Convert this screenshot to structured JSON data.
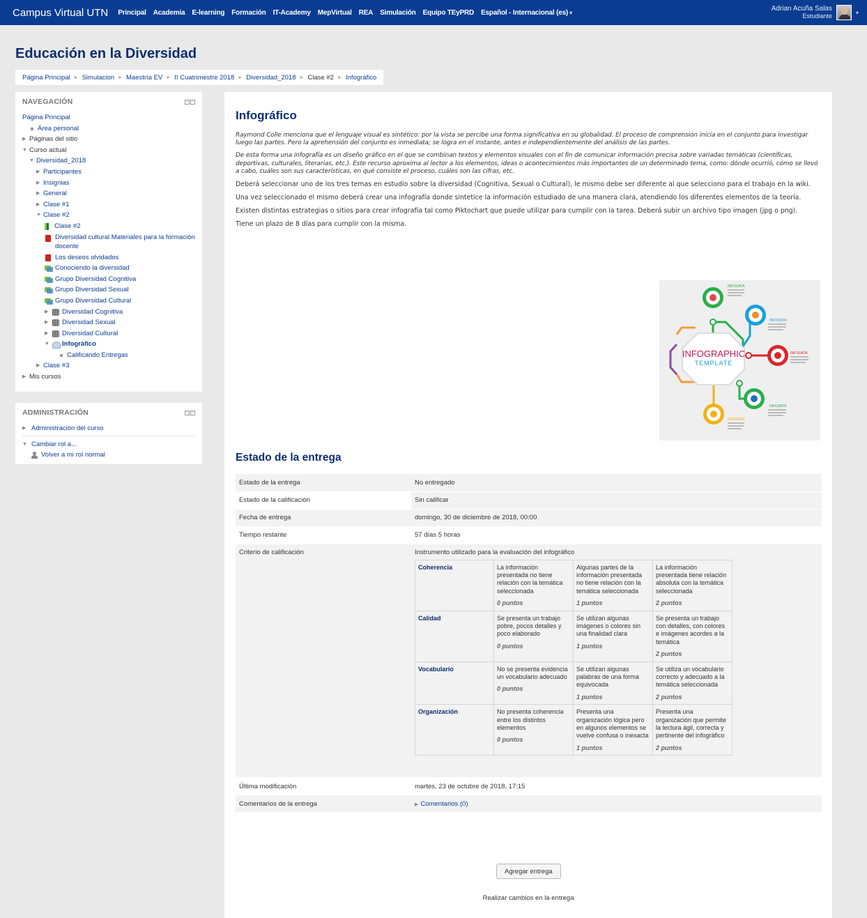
{
  "navbar": {
    "brand": "Campus Virtual UTN",
    "items": [
      "Principal",
      "Academia",
      "E-learning",
      "Formación",
      "IT-Academy",
      "MepVirtual",
      "REA",
      "Simulación",
      "Equipo TEyPRD",
      "Español - Internacional (es)"
    ],
    "user_name": "Adrian Acuña Salas",
    "user_role": "Estudiante"
  },
  "page": {
    "title": "Educación en la Diversidad",
    "breadcrumb": [
      "Página Principal",
      "Simulacion",
      "Maestría EV",
      "II Cuatrimestre 2018",
      "Diversidad_2018",
      "Clase #2",
      "Infográfico"
    ]
  },
  "navigation": {
    "title": "NAVEGACIÓN",
    "items": [
      {
        "label": "Página Principal"
      },
      {
        "label": "Área personal"
      },
      {
        "label": "Páginas del sitio"
      },
      {
        "label": "Curso actual"
      },
      {
        "label": "Diversidad_2018"
      },
      {
        "label": "Participantes"
      },
      {
        "label": "Insignias"
      },
      {
        "label": "General"
      },
      {
        "label": "Clase #1"
      },
      {
        "label": "Clase #2"
      },
      {
        "label": "Clase #2"
      },
      {
        "label": "Diversidad cultural Materiales para la formación docente"
      },
      {
        "label": "Los deseos olvidados"
      },
      {
        "label": "Conociendo la diversidad"
      },
      {
        "label": "Grupo Diversidad Cognitiva"
      },
      {
        "label": "Grupo Diversidad Sexual"
      },
      {
        "label": "Grupo Diversidad Cultural"
      },
      {
        "label": "Diversidad Cognitiva"
      },
      {
        "label": "Diversidad Sexual"
      },
      {
        "label": "Diversidad Cultural"
      },
      {
        "label": "Infográfico"
      },
      {
        "label": "Calificando Entregas"
      },
      {
        "label": "Clase #3"
      },
      {
        "label": "Mis cursos"
      }
    ]
  },
  "administration": {
    "title": "ADMINISTRACIÓN",
    "course_admin": "Administración del curso",
    "switch_role": "Cambiar rol a...",
    "return_role": "Volver a mi rol normal"
  },
  "assignment": {
    "title": "Infográfico",
    "intro": [
      "Raymond Colle menciona que el lenguaje visual es sintético: por la vista se percibe una forma significativa en su globalidad. El proceso de comprensión inicia en el conjunto para investigar luego las partes. Pero la aprehensión del conjunto es inmediata; se logra en el instante, antes e independientemente del análisis de las partes.",
      "De esta forma una infografía es un diseño gráfico en el que se combinan textos y elementos visuales con el fin de comunicar información precisa sobre variadas temáticas (científicas, deportivas, culturales, literarias, etc.). Este recurso aproxima al lector a los elementos, ideas o acontecimientos más importantes de un determinado tema, como: dónde ocurrió, cómo se llevó a cabo, cuáles son sus características, en qué consiste el proceso, cuáles son las cifras, etc.",
      "Deberá seleccionar uno de los tres temas en estudio sobre la diversidad (Cognitiva, Sexual o Cultural), le mismo debe ser diferente al que selecciono para el trabajo en la wiki.",
      "Una vez seleccionado el mismo deberá crear una infografía donde sintetice la información estudiado de una manera clara, atendiendo los diferentes elementos de la teoría.",
      "Existen distintas estrategias o sitios para crear infografía tal como Piktochart que puede utilizar para cumplir con la tarea. Deberá subir un archivo tipo imagen (jpg o png).",
      "Tiene un plazo de 8 días para cumplir con la misma."
    ],
    "infographic": {
      "line1": "INFOGRAPHIC",
      "line2": "TEMPLATE",
      "tag": "INFODATA"
    }
  },
  "submission": {
    "title": "Estado de la entrega",
    "rows": [
      {
        "label": "Estado de la entrega",
        "value": "No entregado"
      },
      {
        "label": "Estado de la calificación",
        "value": "Sin calificar"
      },
      {
        "label": "Fecha de entrega",
        "value": "domingo, 30 de diciembre de 2018, 00:00"
      },
      {
        "label": "Tiempo restante",
        "value": "57 días 5 horas"
      },
      {
        "label": "Criterio de calificación",
        "value": "Instrumento utilizado para la evaluación del infográfico"
      }
    ],
    "last_modified": {
      "label": "Última modificación",
      "value": "martes, 23 de octubre de 2018, 17:15"
    },
    "comments": {
      "label": "Comentarios de la entrega",
      "value": "Comentarios (0)"
    },
    "add_button": "Agregar entrega",
    "edit_note": "Realizar cambios en la entrega"
  },
  "rubric": [
    {
      "criterion": "Coherencia",
      "levels": [
        {
          "text": "La información presentada no tiene relación con la temática seleccionada",
          "points": "0 puntos"
        },
        {
          "text": "Algunas partes de la información presentada no tiene relación con la temática seleccionada",
          "points": "1 puntos"
        },
        {
          "text": "La información presentada tiene relación absoluta con la temática seleccionada",
          "points": "2 puntos"
        }
      ]
    },
    {
      "criterion": "Calidad",
      "levels": [
        {
          "text": "Se presenta un trabajo pobre, pocos detalles y poco elaborado",
          "points": "0 puntos"
        },
        {
          "text": "Se utilizan algunas imágenes o colores sin una finalidad clara",
          "points": "1 puntos"
        },
        {
          "text": "Se presenta un trabajo con detalles, con colores e imágenes acordes a la temática",
          "points": "2 puntos"
        }
      ]
    },
    {
      "criterion": "Vocabulario",
      "levels": [
        {
          "text": "No se presenta evidencia un vocabulario adecuado",
          "points": "0 puntos"
        },
        {
          "text": "Se utilizan algunas palabras de una forma equivocada",
          "points": "1 puntos"
        },
        {
          "text": "Se utiliza un vocabulario correcto y adecuado a la temática seleccionada",
          "points": "2 puntos"
        }
      ]
    },
    {
      "criterion": "Organización",
      "levels": [
        {
          "text": "No presenta coherencia entre los distintos elementos",
          "points": "0 puntos"
        },
        {
          "text": "Presenta una organización lógica pero en algunos elementos se vuelve confusa o inexacta",
          "points": "1 puntos"
        },
        {
          "text": "Presenta una organización que permite la lectura ágil, correcta y pertinente del infográfico",
          "points": "2 puntos"
        }
      ]
    }
  ]
}
